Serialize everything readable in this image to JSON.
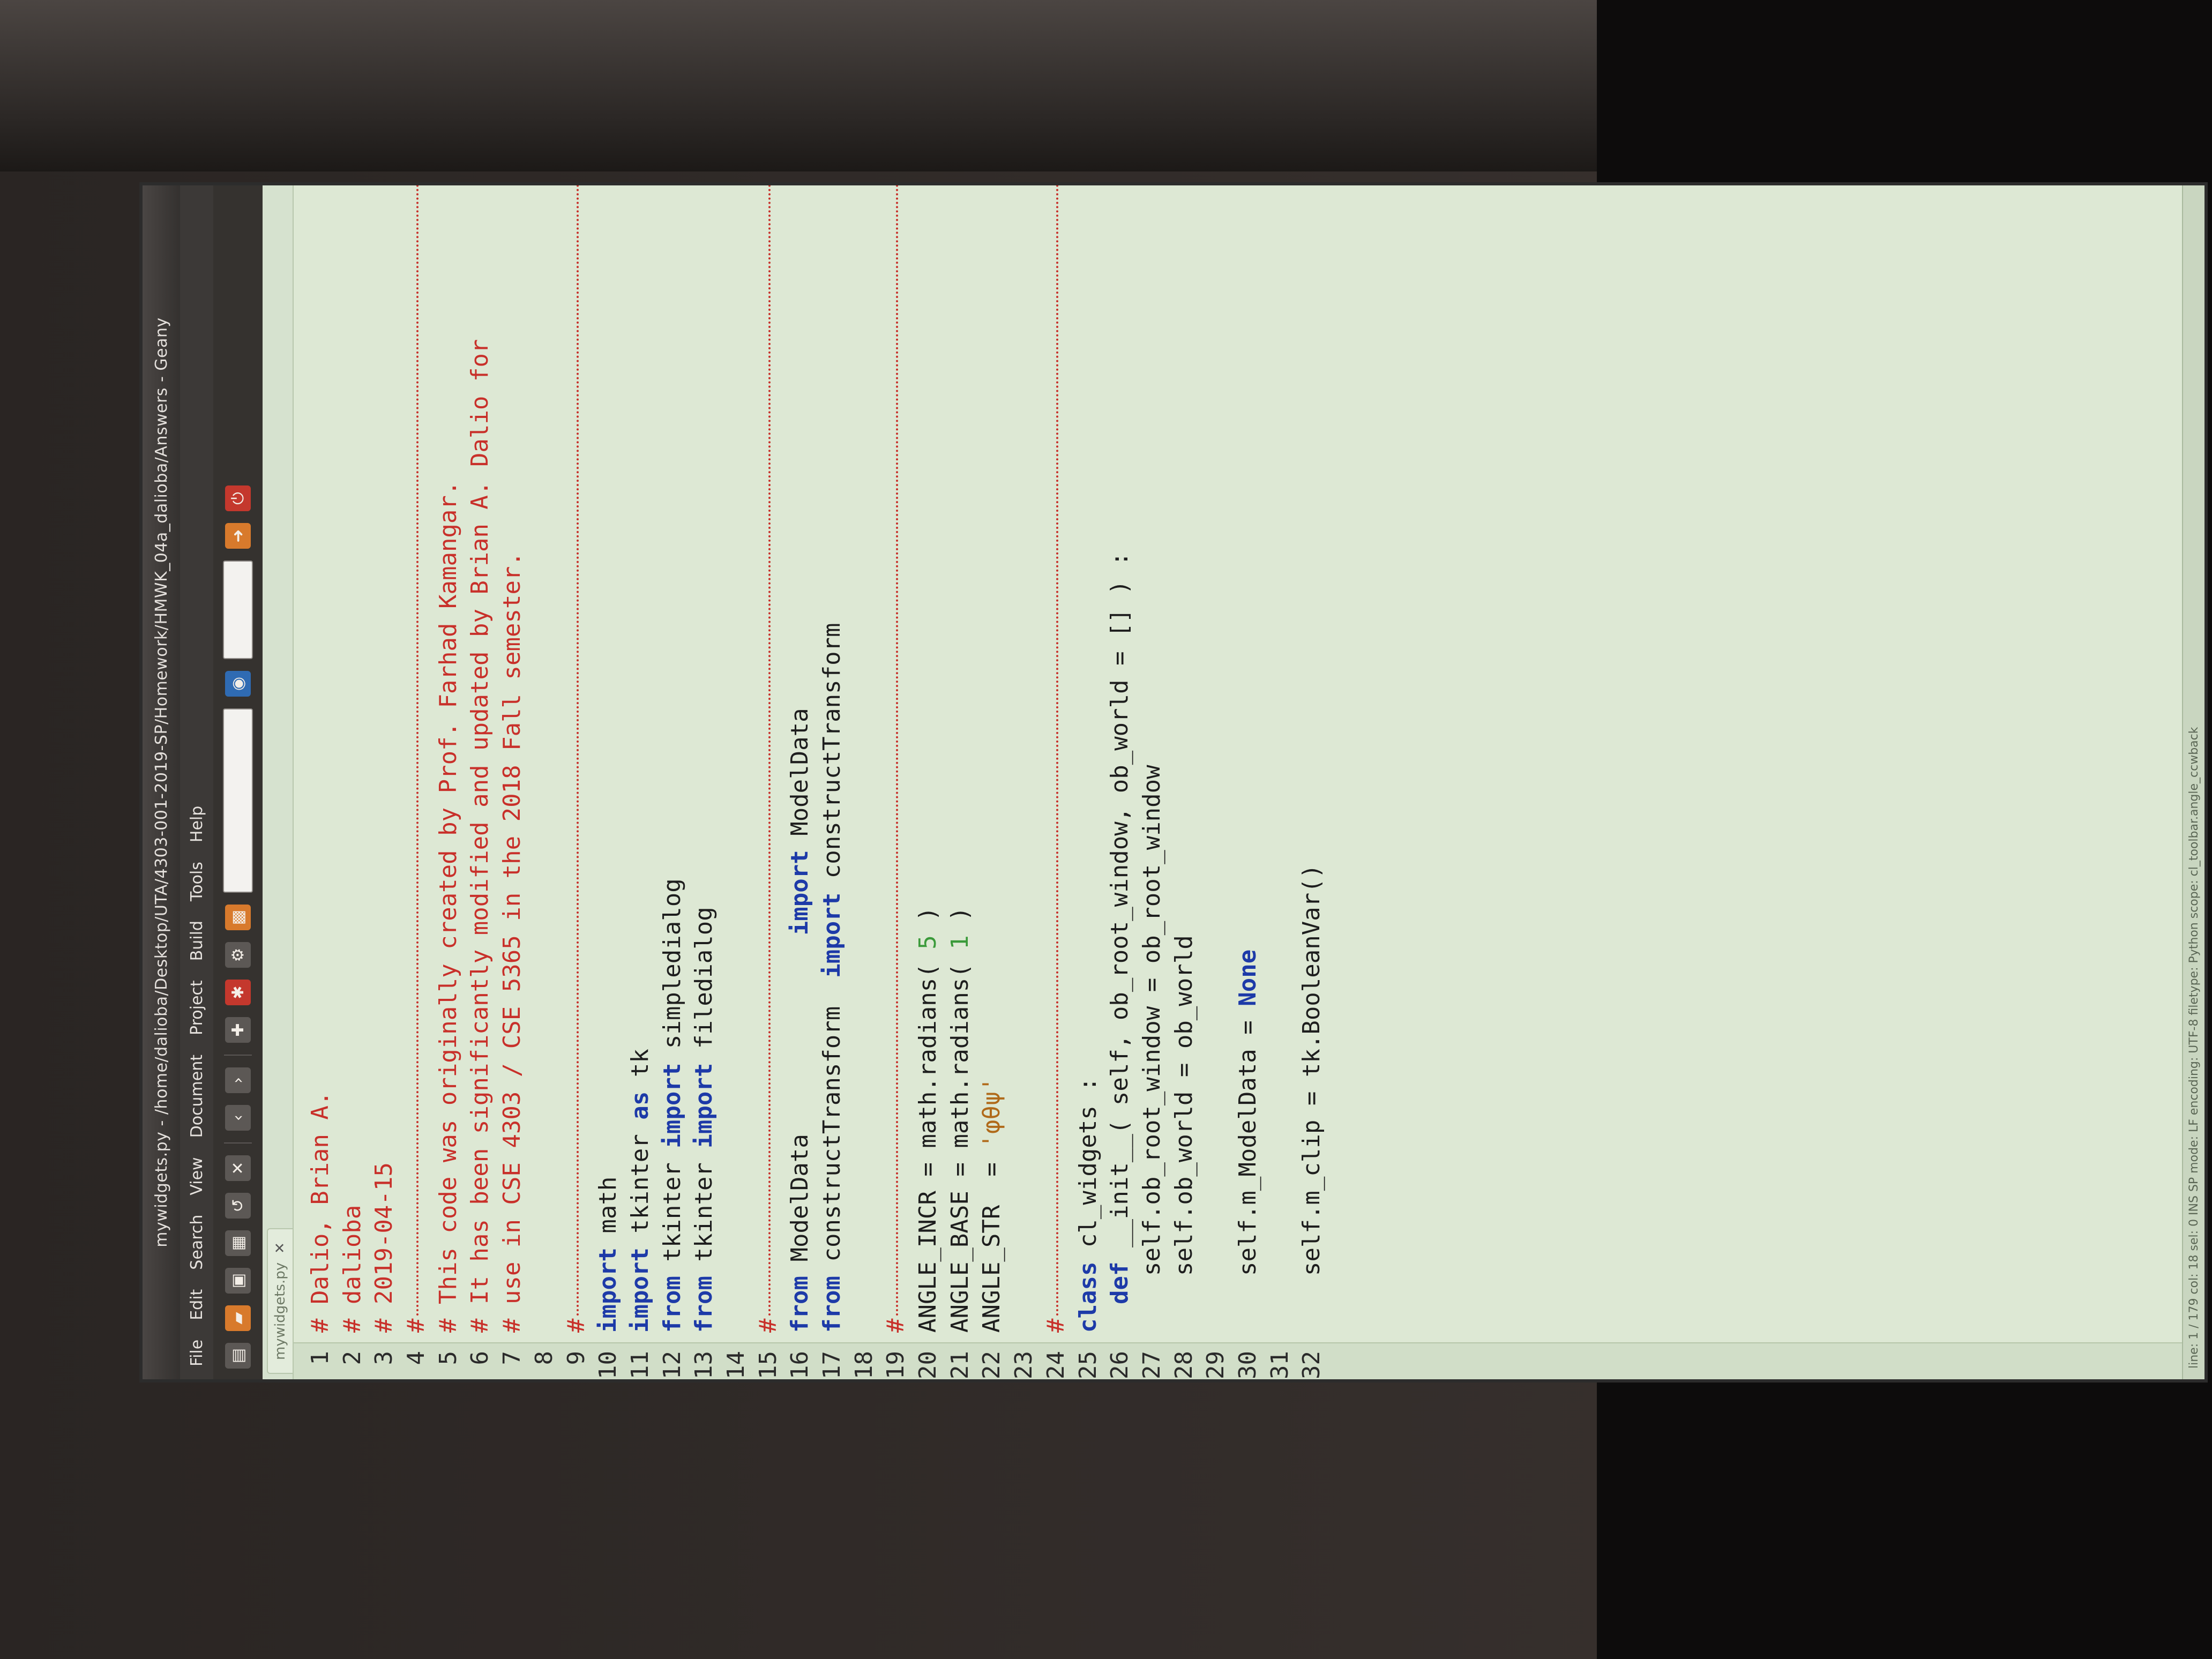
{
  "window": {
    "title": "mywidgets.py - /home/dalioba/Desktop/UTA/4303-001-2019-SP/Homework/HMWK_04a_dalioba/Answers - Geany"
  },
  "menu": {
    "items": [
      "File",
      "Edit",
      "Search",
      "View",
      "Document",
      "Project",
      "Build",
      "Tools",
      "Help"
    ]
  },
  "tabs": [
    {
      "label": "mywidgets.py"
    }
  ],
  "status": {
    "text": "line: 1 / 179    col: 18    sel: 0    INS    SP    mode: LF    encoding: UTF-8    filetype: Python    scope: cl_toolbar.angle_ccwback"
  },
  "code": {
    "line_numbers": [
      "1",
      "2",
      "3",
      "4",
      "5",
      "6",
      "7",
      "8",
      "9",
      "10",
      "11",
      "12",
      "13",
      "14",
      "15",
      "16",
      "17",
      "18",
      "19",
      "20",
      "21",
      "22",
      "23",
      "24",
      "25",
      "26",
      "27",
      "28",
      "29",
      "30",
      "31",
      "32"
    ],
    "lines": [
      {
        "type": "comment",
        "text": "# Dalio, Brian A."
      },
      {
        "type": "comment",
        "text": "# dalioba"
      },
      {
        "type": "comment",
        "text": "# 2019-04-15"
      },
      {
        "type": "sep",
        "text": "#"
      },
      {
        "type": "comment",
        "text": "# This code was originally created by Prof. Farhad Kamangar."
      },
      {
        "type": "comment",
        "text": "# It has been significantly modified and updated by Brian A. Dalio for"
      },
      {
        "type": "comment",
        "text": "# use in CSE 4303 / CSE 5365 in the 2018 Fall semester."
      },
      {
        "type": "blank",
        "text": ""
      },
      {
        "type": "sep",
        "text": "#"
      },
      {
        "type": "code",
        "text": "import math"
      },
      {
        "type": "code",
        "text": "import tkinter as tk"
      },
      {
        "type": "code",
        "text": "from tkinter import simpledialog"
      },
      {
        "type": "code",
        "text": "from tkinter import filedialog"
      },
      {
        "type": "blank",
        "text": ""
      },
      {
        "type": "sep",
        "text": "#"
      },
      {
        "type": "code",
        "text": "from ModelData              import ModelData"
      },
      {
        "type": "code",
        "text": "from constructTransform  import constructTransform"
      },
      {
        "type": "blank",
        "text": ""
      },
      {
        "type": "sep",
        "text": "#"
      },
      {
        "type": "code",
        "text": "ANGLE_INCR = math.radians( 5 )"
      },
      {
        "type": "code",
        "text": "ANGLE_BASE = math.radians( 1 )"
      },
      {
        "type": "code",
        "text": "ANGLE_STR  = 'φθψ'"
      },
      {
        "type": "blank",
        "text": ""
      },
      {
        "type": "sep",
        "text": "#"
      },
      {
        "type": "code",
        "text": "class cl_widgets :"
      },
      {
        "type": "code",
        "text": "  def __init__( self, ob_root_window, ob_world = [] ) :"
      },
      {
        "type": "code",
        "text": "    self.ob_root_window = ob_root_window"
      },
      {
        "type": "code",
        "text": "    self.ob_world = ob_world"
      },
      {
        "type": "blank",
        "text": ""
      },
      {
        "type": "code",
        "text": "    self.m_ModelData = None"
      },
      {
        "type": "blank",
        "text": ""
      },
      {
        "type": "code",
        "text": "    self.m_clip = tk.BooleanVar()"
      }
    ]
  },
  "colors": {
    "editor_bg": "#dde8d4",
    "comment": "#c8302a",
    "keyword": "#1d3aa8",
    "number": "#3a9a3a",
    "string": "#b06a1a"
  }
}
